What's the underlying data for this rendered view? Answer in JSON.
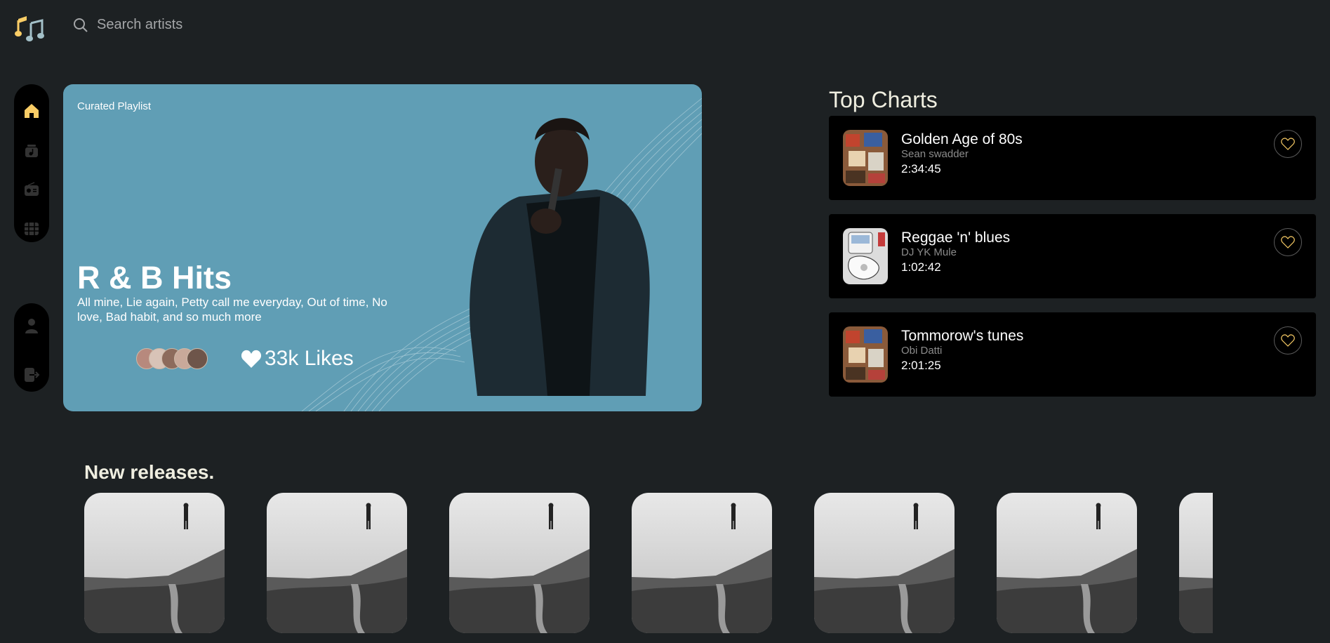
{
  "app": {
    "logo_icon": "music-note-icon",
    "accent_color": "#facd66"
  },
  "search": {
    "placeholder": "Search artists",
    "value": ""
  },
  "nav": {
    "main_items": [
      {
        "id": "home",
        "icon": "home-icon",
        "active": true
      },
      {
        "id": "my-collection",
        "icon": "music-library-icon",
        "active": false
      },
      {
        "id": "radio",
        "icon": "radio-icon",
        "active": false
      },
      {
        "id": "videos",
        "icon": "video-icon",
        "active": false
      }
    ],
    "user_items": [
      {
        "id": "profile",
        "icon": "profile-icon"
      },
      {
        "id": "logout",
        "icon": "logout-icon"
      }
    ]
  },
  "hero": {
    "tag": "Curated Playlist",
    "title": "R & B Hits",
    "description": "All mine, Lie again, Petty call me everyday, Out of time, No love, Bad habit, and so much more",
    "likes": "33k Likes",
    "background_color": "#609eb5"
  },
  "top_charts": {
    "title": "Top Charts",
    "items": [
      {
        "name": "Golden Age of 80s",
        "artist": "Sean swadder",
        "duration": "2:34:45"
      },
      {
        "name": "Reggae 'n' blues",
        "artist": "DJ YK Mule",
        "duration": "1:02:42"
      },
      {
        "name": "Tommorow's tunes",
        "artist": "Obi Datti",
        "duration": "2:01:25"
      }
    ]
  },
  "new_releases": {
    "title": "New releases."
  }
}
